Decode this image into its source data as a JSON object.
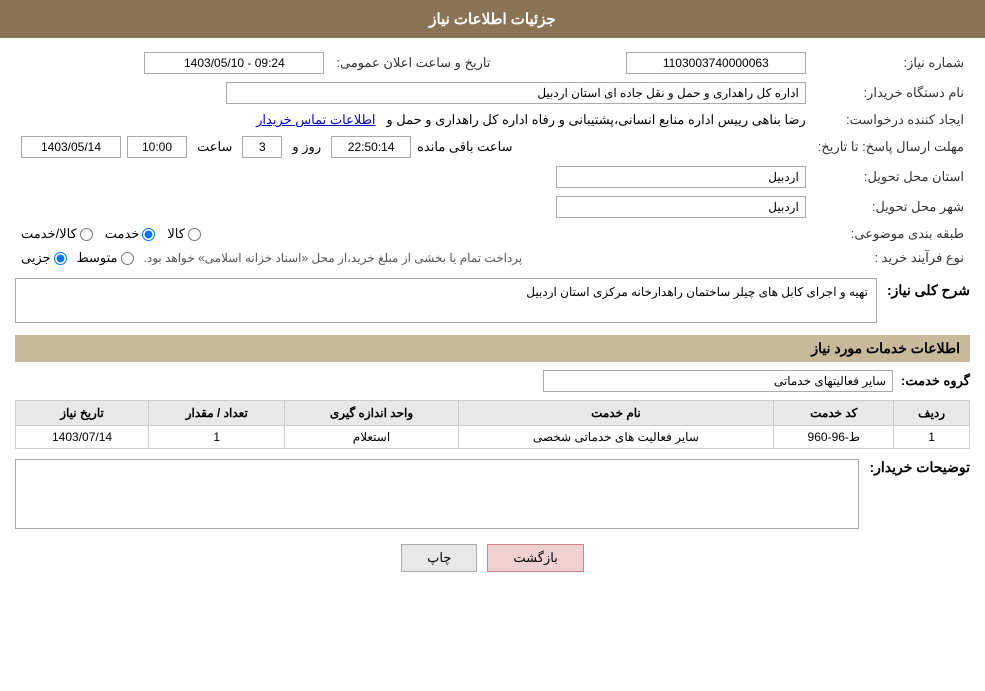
{
  "header": {
    "title": "جزئیات اطلاعات نیاز"
  },
  "fields": {
    "need_number_label": "شماره نیاز:",
    "need_number_value": "1103003740000063",
    "announce_date_label": "تاریخ و ساعت اعلان عمومی:",
    "announce_date_value": "1403/05/10 - 09:24",
    "buyer_org_label": "نام دستگاه خریدار:",
    "buyer_org_value": "اداره کل راهداری و حمل و نقل جاده ای استان اردبیل",
    "creator_label": "ایجاد کننده درخواست:",
    "creator_value": "رضا بناهی رییس اداره منابع انسانی،پشتیبانی و رفاه اداره کل راهداری و حمل و",
    "creator_link": "اطلاعات تماس خریدار",
    "deadline_label": "مهلت ارسال پاسخ: تا تاریخ:",
    "deadline_date": "1403/05/14",
    "deadline_time_label": "ساعت",
    "deadline_time": "10:00",
    "deadline_days_label": "روز و",
    "deadline_days": "3",
    "deadline_remaining_label": "ساعت باقی مانده",
    "deadline_remaining": "22:50:14",
    "province_label": "استان محل تحویل:",
    "province_value": "اردبیل",
    "city_label": "شهر محل تحویل:",
    "city_value": "اردبیل",
    "category_label": "طبقه بندی موضوعی:",
    "category_options": [
      "کالا",
      "خدمت",
      "کالا/خدمت"
    ],
    "category_selected": "خدمت",
    "purchase_type_label": "نوع فرآیند خرید :",
    "purchase_type_options": [
      "جزیی",
      "متوسط"
    ],
    "purchase_type_note": "پرداخت تمام یا بخشی از مبلغ خرید،از محل «اسناد خزانه اسلامی» خواهد بود.",
    "need_desc_label": "شرح کلی نیاز:",
    "need_desc_value": "تهیه و اجرای کابل های چیلر ساختمان راهدارخانه مرکزی استان اردبیل",
    "services_title": "اطلاعات خدمات مورد نیاز",
    "service_group_label": "گروه خدمت:",
    "service_group_value": "سایر فعالیتهای خدماتی",
    "table": {
      "headers": [
        "ردیف",
        "کد خدمت",
        "نام خدمت",
        "واحد اندازه گیری",
        "تعداد / مقدار",
        "تاریخ نیاز"
      ],
      "rows": [
        {
          "row": "1",
          "code": "ط-96-960",
          "name": "سایر فعالیت های خدماتی شخصی",
          "unit": "استعلام",
          "count": "1",
          "date": "1403/07/14"
        }
      ]
    },
    "buyer_notes_label": "توضیحات خریدار:",
    "buyer_notes_value": ""
  },
  "buttons": {
    "print": "چاپ",
    "back": "بازگشت"
  }
}
